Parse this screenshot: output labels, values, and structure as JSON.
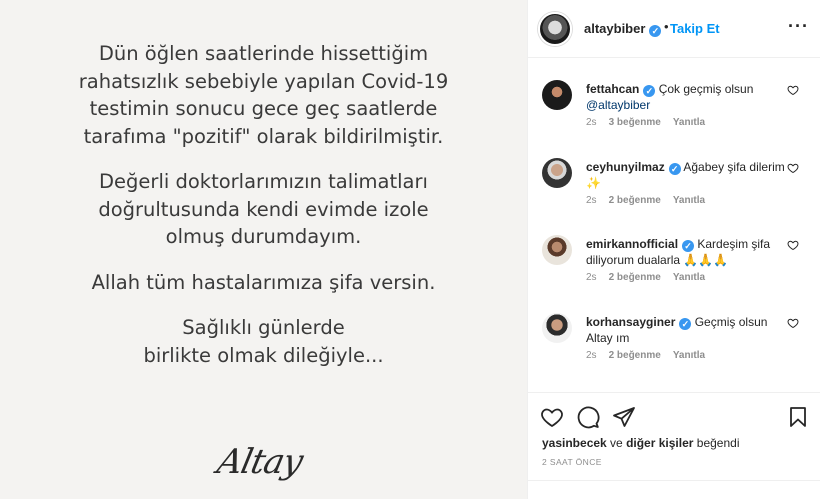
{
  "post": {
    "paragraphs": [
      [
        "Dün öğlen saatlerinde hissettiğim",
        "rahatsızlık sebebiyle yapılan Covid-19",
        "testimin  sonucu gece geç saatlerde",
        "tarafıma \"pozitif\" olarak bildirilmiştir."
      ],
      [
        "Değerli doktorlarımızın talimatları",
        "doğrultusunda kendi evimde izole",
        "olmuş durumdayım."
      ],
      [
        "Allah tüm hastalarımıza şifa versin."
      ],
      [
        "Sağlıklı günlerde",
        "birlikte olmak dileğiyle..."
      ]
    ],
    "signature": "Altay"
  },
  "header": {
    "username": "altaybiber",
    "dot": "•",
    "follow_label": "Takip Et",
    "more_icon": "more-options-icon"
  },
  "comments": [
    {
      "username": "fettahcan",
      "text": "Çok geçmiş olsun",
      "mention": "@altaybiber",
      "time": "2s",
      "likes": "3 beğenme",
      "reply": "Yanıtla"
    },
    {
      "username": "ceyhunyilmaz",
      "text": "Ağabey şifa dilerim ✨",
      "mention": "",
      "time": "2s",
      "likes": "2 beğenme",
      "reply": "Yanıtla"
    },
    {
      "username": "emirkannofficial",
      "text": "Kardeşim şifa diliyorum dualarla 🙏🙏🙏",
      "mention": "",
      "time": "2s",
      "likes": "2 beğenme",
      "reply": "Yanıtla"
    },
    {
      "username": "korhansayginer",
      "text": "Geçmiş olsun Altay ım",
      "mention": "",
      "time": "2s",
      "likes": "2 beğenme",
      "reply": "Yanıtla"
    }
  ],
  "likes_line": {
    "user": "yasinbecek",
    "connector": " ve ",
    "others": "diğer kişiler",
    "suffix": " beğendi"
  },
  "timestamp": "2 SAAT ÖNCE",
  "colors": {
    "accent": "#0095f6",
    "verified": "#3897f0",
    "muted": "#8e8e8e"
  }
}
